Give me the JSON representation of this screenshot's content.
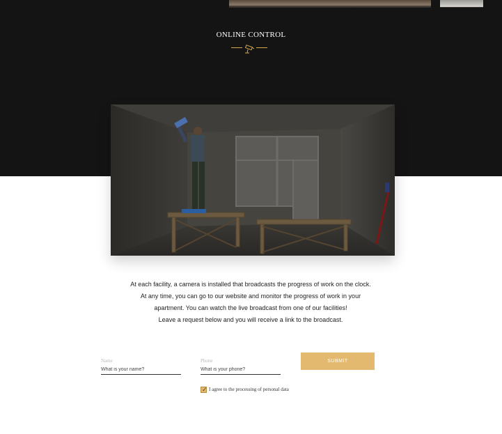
{
  "section": {
    "title": "ONLINE CONTROL",
    "ornament_icon": "cctv-camera-icon",
    "accent_color": "#d4a94c"
  },
  "photo": {
    "subject": "worker-painting-ceiling-photo"
  },
  "description": {
    "lines": [
      "At each facility, a camera is installed that broadcasts the progress of work on the clock.",
      "At any time, you can go to our website and monitor the progress of work in your",
      "apartment. You can watch the live broadcast from one of our facilities!",
      "Leave a request below and you will receive a link to the broadcast."
    ]
  },
  "form": {
    "name": {
      "label": "Name",
      "placeholder": "What is your name?",
      "value": ""
    },
    "phone": {
      "label": "Phone",
      "placeholder": "What is your phone?",
      "value": ""
    },
    "submit_label": "SUBMIT",
    "button_color": "#e2b96e",
    "agree": {
      "checked": true,
      "label": "I agree to the processing of personal data"
    }
  }
}
